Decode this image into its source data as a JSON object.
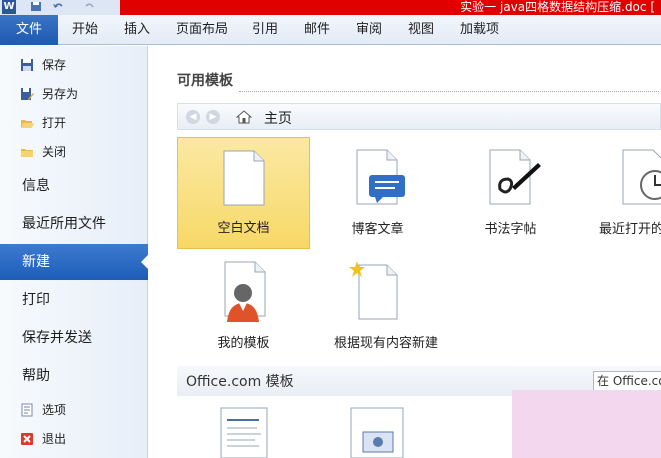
{
  "window": {
    "doc_title": "实验一 java四格数据结构压缩.doc [",
    "app_icon": "W"
  },
  "ribbon": {
    "tabs": [
      {
        "label": "文件"
      },
      {
        "label": "开始"
      },
      {
        "label": "插入"
      },
      {
        "label": "页面布局"
      },
      {
        "label": "引用"
      },
      {
        "label": "邮件"
      },
      {
        "label": "审阅"
      },
      {
        "label": "视图"
      },
      {
        "label": "加载项"
      }
    ]
  },
  "backstage": {
    "items": [
      {
        "label": "保存",
        "icon": "save-icon"
      },
      {
        "label": "另存为",
        "icon": "save-as-icon"
      },
      {
        "label": "打开",
        "icon": "open-folder-icon"
      },
      {
        "label": "关闭",
        "icon": "close-folder-icon"
      },
      {
        "label": "信息"
      },
      {
        "label": "最近所用文件"
      },
      {
        "label": "新建"
      },
      {
        "label": "打印"
      },
      {
        "label": "保存并发送"
      },
      {
        "label": "帮助"
      },
      {
        "label": "选项",
        "icon": "options-icon"
      },
      {
        "label": "退出",
        "icon": "exit-icon"
      }
    ],
    "active": "新建"
  },
  "main": {
    "section_title": "可用模板",
    "breadcrumb": "主页",
    "templates": [
      {
        "label": "空白文档",
        "icon": "blank-document-icon",
        "selected": true
      },
      {
        "label": "博客文章",
        "icon": "blog-post-icon"
      },
      {
        "label": "书法字帖",
        "icon": "calligraphy-icon"
      },
      {
        "label": "最近打开的",
        "icon": "recent-templates-icon"
      },
      {
        "label": "我的模板",
        "icon": "my-templates-icon"
      },
      {
        "label": "根据现有内容新建",
        "icon": "new-from-existing-icon"
      }
    ],
    "office_section_title": "Office.com 模板",
    "search_placeholder": "在 Office.com 上"
  },
  "colors": {
    "accent": "#1f59b0",
    "selected_tile": "#f7d866",
    "title_band": "#e00000"
  }
}
